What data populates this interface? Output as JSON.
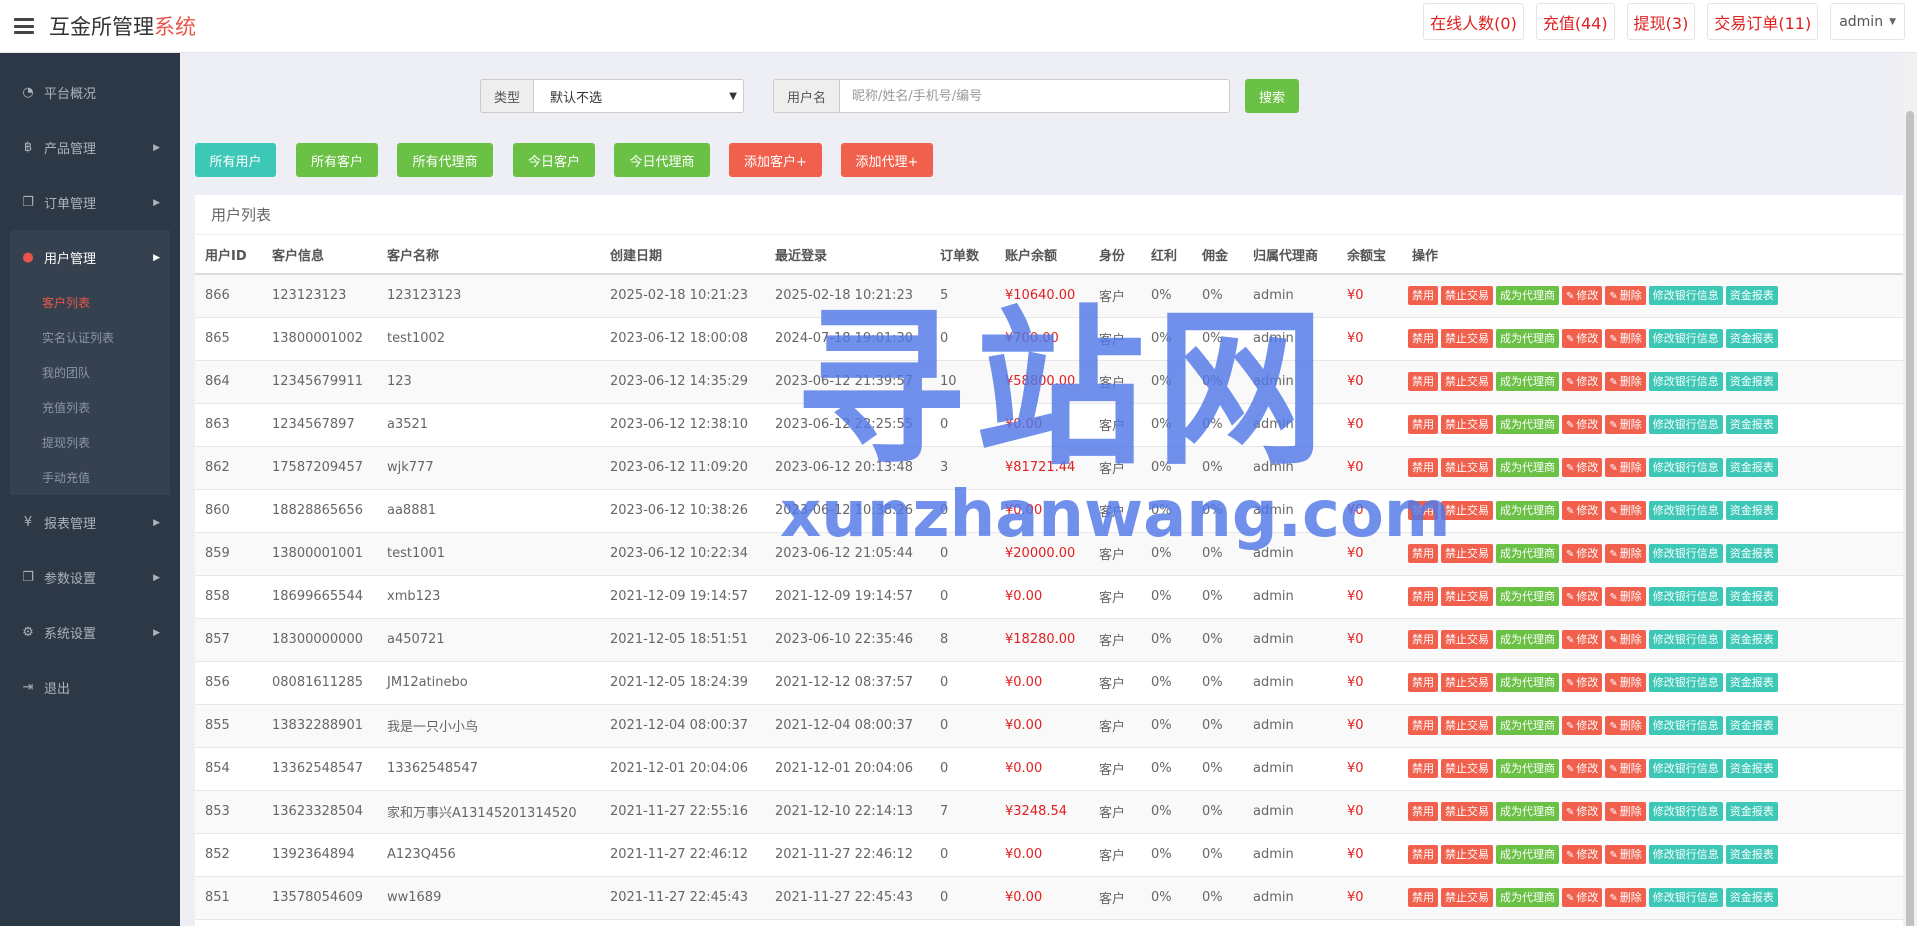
{
  "header": {
    "brand_main": "互金所管理",
    "brand_accent": "系统",
    "buttons": [
      "在线人数(0)",
      "充值(44)",
      "提现(3)",
      "交易订单(11)"
    ],
    "admin_label": "admin"
  },
  "sidebar": {
    "items": [
      {
        "label": "平台概况",
        "icon": "dashboard-icon",
        "glyph": "◔"
      },
      {
        "label": "产品管理",
        "icon": "bitcoin-icon",
        "glyph": "฿"
      },
      {
        "label": "订单管理",
        "icon": "copy-icon",
        "glyph": "❐"
      },
      {
        "label": "用户管理",
        "icon": "user-icon",
        "glyph": "●"
      },
      {
        "label": "报表管理",
        "icon": "yen-icon",
        "glyph": "¥"
      },
      {
        "label": "参数设置",
        "icon": "copy-icon",
        "glyph": "❐"
      },
      {
        "label": "系统设置",
        "icon": "cogs-icon",
        "glyph": "⚙"
      },
      {
        "label": "退出",
        "icon": "signout-icon",
        "glyph": "⇥"
      }
    ],
    "submenu": [
      "客户列表",
      "实名认证列表",
      "我的团队",
      "充值列表",
      "提现列表",
      "手动充值"
    ]
  },
  "search": {
    "type_label": "类型",
    "type_value": "默认不选",
    "user_label": "用户名",
    "user_placeholder": "昵称/姓名/手机号/编号",
    "search_button": "搜索"
  },
  "filters": [
    "所有用户",
    "所有客户",
    "所有代理商",
    "今日客户",
    "今日代理商",
    "添加客户+",
    "添加代理+"
  ],
  "table": {
    "title": "用户列表",
    "headers": [
      "用户ID",
      "客户信息",
      "客户名称",
      "创建日期",
      "最近登录",
      "订单数",
      "账户余额",
      "身份",
      "红利",
      "佣金",
      "归属代理商",
      "余额宝",
      "操作"
    ],
    "op_labels": [
      "禁用",
      "禁止交易",
      "成为代理商",
      "修改",
      "删除",
      "修改银行信息",
      "资金报表"
    ],
    "rows": [
      [
        "866",
        "123123123",
        "123123123",
        "2025-02-18 10:21:23",
        "2025-02-18 10:21:23",
        "5",
        "¥10640.00",
        "客户",
        "0%",
        "0%",
        "admin",
        "¥0"
      ],
      [
        "865",
        "13800001002",
        "test1002",
        "2023-06-12 18:00:08",
        "2024-07-18 19:01:30",
        "0",
        "¥700.00",
        "客户",
        "0%",
        "0%",
        "admin",
        "¥0"
      ],
      [
        "864",
        "12345679911",
        "123",
        "2023-06-12 14:35:29",
        "2023-06-12 21:39:57",
        "10",
        "¥58800.00",
        "客户",
        "0%",
        "0%",
        "admin",
        "¥0"
      ],
      [
        "863",
        "1234567897",
        "a3521",
        "2023-06-12 12:38:10",
        "2023-06-12 22:25:55",
        "0",
        "¥0.00",
        "客户",
        "0%",
        "0%",
        "admin",
        "¥0"
      ],
      [
        "862",
        "17587209457",
        "wjk777",
        "2023-06-12 11:09:20",
        "2023-06-12 20:13:48",
        "3",
        "¥81721.44",
        "客户",
        "0%",
        "0%",
        "admin",
        "¥0"
      ],
      [
        "860",
        "18828865656",
        "aa8881",
        "2023-06-12 10:38:26",
        "2023-06-12 10:38:26",
        "0",
        "¥0.00",
        "客户",
        "0%",
        "0%",
        "admin",
        "¥0"
      ],
      [
        "859",
        "13800001001",
        "test1001",
        "2023-06-12 10:22:34",
        "2023-06-12 21:05:44",
        "0",
        "¥20000.00",
        "客户",
        "0%",
        "0%",
        "admin",
        "¥0"
      ],
      [
        "858",
        "18699665544",
        "xmb123",
        "2021-12-09 19:14:57",
        "2021-12-09 19:14:57",
        "0",
        "¥0.00",
        "客户",
        "0%",
        "0%",
        "admin",
        "¥0"
      ],
      [
        "857",
        "18300000000",
        "a450721",
        "2021-12-05 18:51:51",
        "2023-06-10 22:35:46",
        "8",
        "¥18280.00",
        "客户",
        "0%",
        "0%",
        "admin",
        "¥0"
      ],
      [
        "856",
        "08081611285",
        "JM12atinebo",
        "2021-12-05 18:24:39",
        "2021-12-12 08:37:57",
        "0",
        "¥0.00",
        "客户",
        "0%",
        "0%",
        "admin",
        "¥0"
      ],
      [
        "855",
        "13832288901",
        "我是一只小小鸟",
        "2021-12-04 08:00:37",
        "2021-12-04 08:00:37",
        "0",
        "¥0.00",
        "客户",
        "0%",
        "0%",
        "admin",
        "¥0"
      ],
      [
        "854",
        "13362548547",
        "13362548547",
        "2021-12-01 20:04:06",
        "2021-12-01 20:04:06",
        "0",
        "¥0.00",
        "客户",
        "0%",
        "0%",
        "admin",
        "¥0"
      ],
      [
        "853",
        "13623328504",
        "家和万事兴A13145201314520",
        "2021-11-27 22:55:16",
        "2021-12-10 22:14:13",
        "7",
        "¥3248.54",
        "客户",
        "0%",
        "0%",
        "admin",
        "¥0"
      ],
      [
        "852",
        "1392364894",
        "A123Q456",
        "2021-11-27 22:46:12",
        "2021-11-27 22:46:12",
        "0",
        "¥0.00",
        "客户",
        "0%",
        "0%",
        "admin",
        "¥0"
      ],
      [
        "851",
        "13578054609",
        "ww1689",
        "2021-11-27 22:45:43",
        "2021-11-27 22:45:43",
        "0",
        "¥0.00",
        "客户",
        "0%",
        "0%",
        "admin",
        "¥0"
      ]
    ]
  },
  "watermark": {
    "cn": "寻站网",
    "en": "xunzhanwang.com"
  },
  "colors": {
    "sidebar_bg": "#2d3846",
    "accent_red": "#e8564b",
    "button_teal": "#3cc7b6",
    "button_green": "#6ac145",
    "button_red": "#f0604d",
    "money_red": "#e02020"
  }
}
